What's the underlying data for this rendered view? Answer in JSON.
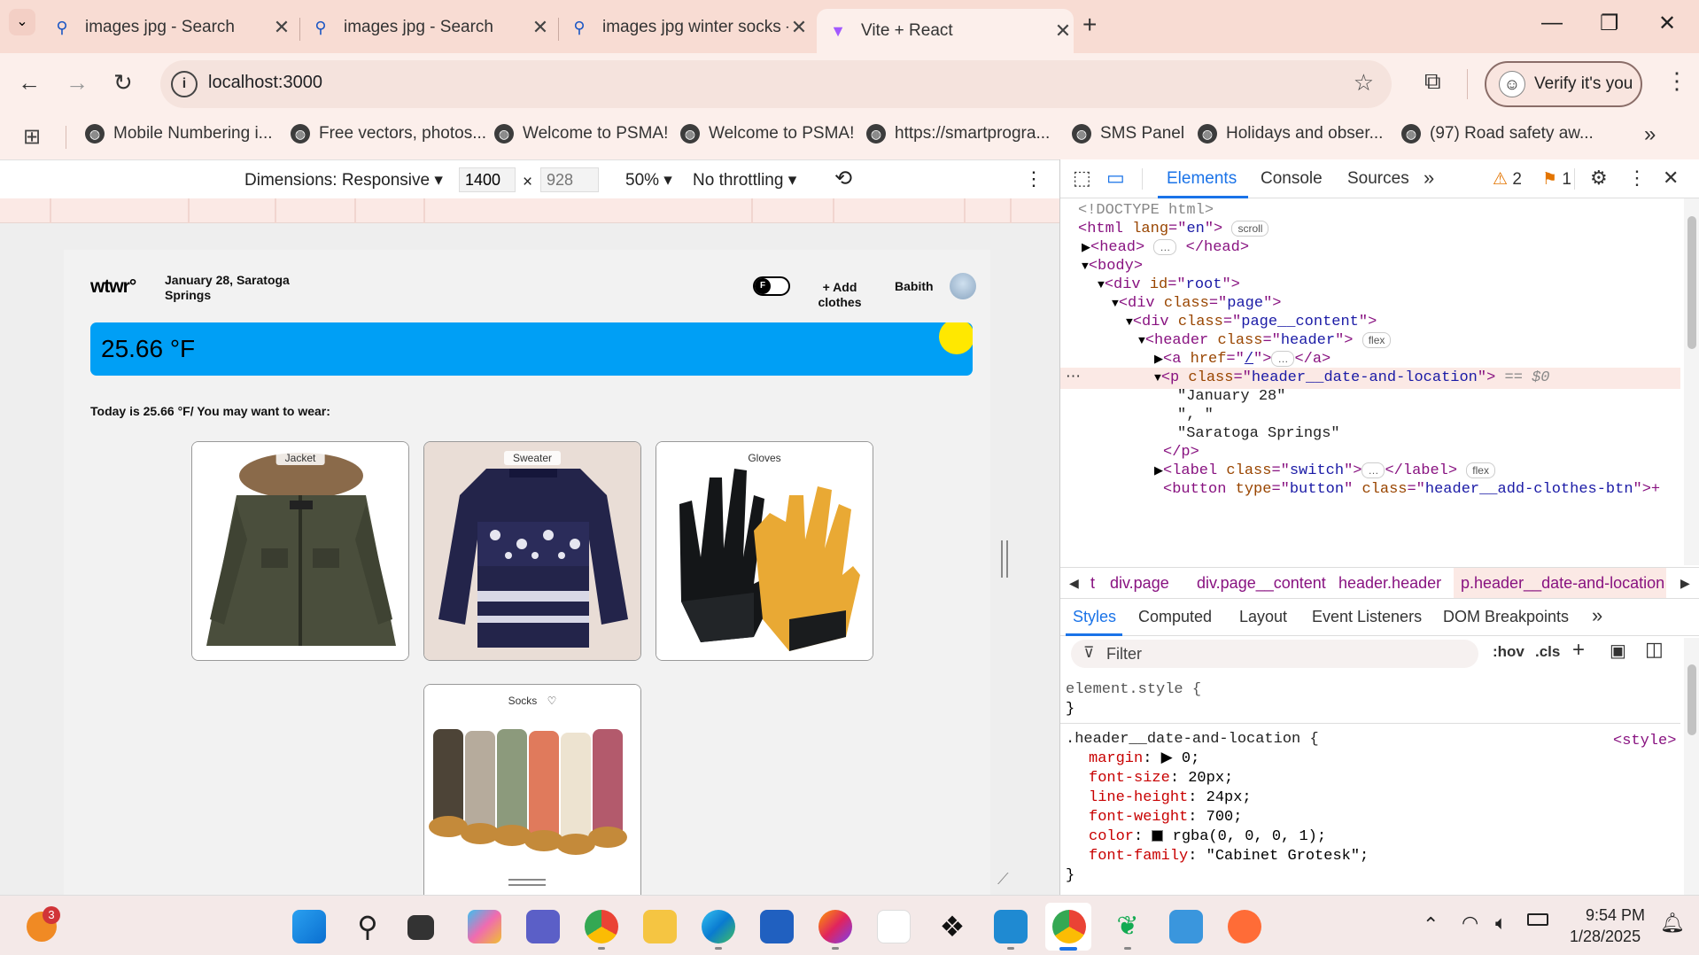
{
  "browser": {
    "tabs": [
      {
        "title": "images jpg - Search"
      },
      {
        "title": "images jpg - Search"
      },
      {
        "title": "images jpg winter socks - Searc"
      },
      {
        "title": "Vite + React"
      }
    ],
    "url": "localhost:3000",
    "profile_button": "Verify it's you",
    "bookmarks": [
      "Mobile Numbering i...",
      "Free vectors, photos...",
      "Welcome to PSMA!",
      "Welcome to PSMA!",
      "https://smartprogra...",
      "SMS Panel",
      "Holidays and obser...",
      "(97) Road safety aw..."
    ]
  },
  "device_toolbar": {
    "dimensions": "Dimensions: Responsive",
    "width": "1400",
    "height_placeholder": "928",
    "zoom": "50%",
    "throttling": "No throttling"
  },
  "app": {
    "logo": "wtwr°",
    "date_location": "January 28, Saratoga Springs",
    "toggle_letter": "F",
    "add_clothes": "+ Add clothes",
    "username": "Babith",
    "temperature": "25.66 °F",
    "wear_text": "Today is 25.66 °F/ You may want to wear:",
    "items": [
      {
        "name": "Jacket"
      },
      {
        "name": "Sweater"
      },
      {
        "name": "Gloves"
      },
      {
        "name": "Socks",
        "liked_icon": "heart-outline"
      }
    ]
  },
  "devtools": {
    "tabs": [
      "Elements",
      "Console",
      "Sources"
    ],
    "warnings": "2",
    "issues": "1",
    "dom": {
      "doctype": "<!DOCTYPE html>",
      "html_lang": "en",
      "scroll_badge": "scroll",
      "flex_badge": "flex",
      "root_id": "root",
      "page_class": "page",
      "content_class": "page__content",
      "header_class": "header",
      "href": "/",
      "p_class": "header__date-and-location",
      "selected_marker": "== $0",
      "text1": "\"January 28\"",
      "text2": "\", \"",
      "text3": "\"Saratoga Springs\"",
      "label_class": "switch",
      "button_type": "button",
      "button_class": "header__add-clothes-btn"
    },
    "breadcrumbs": [
      "t",
      "div.page",
      "div.page__content",
      "header.header",
      "p.header__date-and-location"
    ],
    "style_tabs": [
      "Styles",
      "Computed",
      "Layout",
      "Event Listeners",
      "DOM Breakpoints"
    ],
    "filter_placeholder": "Filter",
    "hov": ":hov",
    "cls": ".cls",
    "element_style": "element.style {",
    "rule_selector": ".header__date-and-location {",
    "rule_source": "<style>",
    "props": [
      {
        "name": "margin",
        "value": "▶ 0;"
      },
      {
        "name": "font-size",
        "value": "20px;"
      },
      {
        "name": "line-height",
        "value": "24px;"
      },
      {
        "name": "font-weight",
        "value": "700;"
      },
      {
        "name": "color",
        "value": "rgba(0, 0, 0, 1);"
      },
      {
        "name": "font-family",
        "value": "\"Cabinet Grotesk\";"
      }
    ]
  },
  "taskbar": {
    "notification_count": "3",
    "time": "9:54 PM",
    "date": "1/28/2025"
  },
  "colors": {
    "weather_bar": "#009ff5",
    "sun": "#ffe800",
    "tabstrip": "#f8dcd3",
    "element_tag": "#881280"
  }
}
